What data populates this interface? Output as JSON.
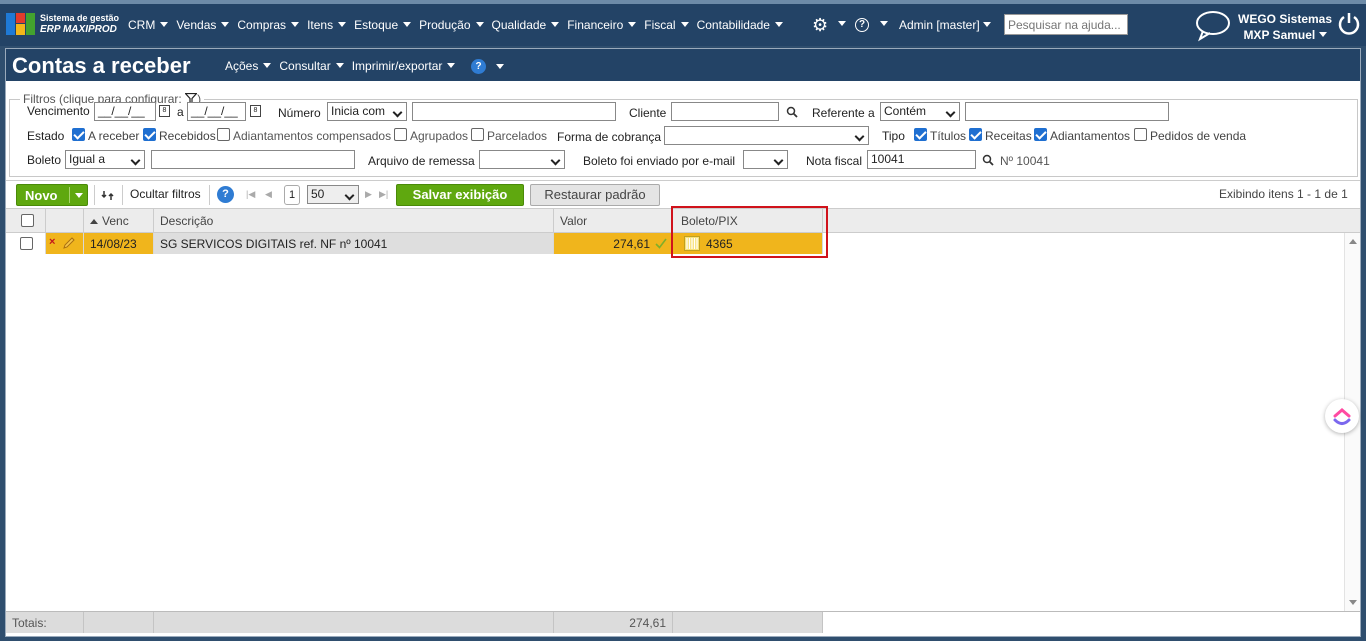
{
  "topbar": {
    "brand_line1": "Sistema de gestão",
    "brand_line2": "ERP MAXIPROD",
    "menu": [
      "CRM",
      "Vendas",
      "Compras",
      "Itens",
      "Estoque",
      "Produção",
      "Qualidade",
      "Financeiro",
      "Fiscal",
      "Contabilidade"
    ],
    "admin_label": "Admin [master]",
    "help_search_placeholder": "Pesquisar na ajuda...",
    "org_line1": "WEGO Sistemas",
    "org_line2": "MXP Samuel",
    "colors": {
      "nav_bg": "#234366",
      "accent_green": "#5fa80f",
      "row_highlight": "#f0b51c"
    }
  },
  "page": {
    "title": "Contas a receber",
    "menu": [
      "Ações",
      "Consultar",
      "Imprimir/exportar"
    ],
    "help_icon": "?"
  },
  "filters": {
    "legend": "Filtros (clique para configurar:",
    "legend_close": ")",
    "vencimento_label": "Vencimento",
    "date_placeholder": "__/__/__",
    "a_label": "a",
    "numero_label": "Número",
    "numero_mode": "Inicia com",
    "cliente_label": "Cliente",
    "referente_label": "Referente a",
    "referente_mode": "Contém",
    "estado_label": "Estado",
    "estado_options": [
      {
        "label": "A receber",
        "checked": true
      },
      {
        "label": "Recebidos",
        "checked": true
      },
      {
        "label": "Adiantamentos compensados",
        "checked": false
      },
      {
        "label": "Agrupados",
        "checked": false
      },
      {
        "label": "Parcelados",
        "checked": false
      }
    ],
    "forma_label": "Forma de cobrança",
    "tipo_label": "Tipo",
    "tipo_options": [
      {
        "label": "Títulos",
        "checked": true
      },
      {
        "label": "Receitas",
        "checked": true
      },
      {
        "label": "Adiantamentos",
        "checked": true
      },
      {
        "label": "Pedidos de venda",
        "checked": false
      }
    ],
    "boleto_label": "Boleto",
    "boleto_mode": "Igual a",
    "arquivo_label": "Arquivo de remessa",
    "enviado_label": "Boleto foi enviado por e-mail",
    "nota_label": "Nota fiscal",
    "nota_value": "10041",
    "nota_result": "Nº 10041"
  },
  "toolbar": {
    "novo_label": "Novo",
    "ocultar_label": "Ocultar filtros",
    "page_number": "1",
    "page_size": "50",
    "salvar_label": "Salvar exibição",
    "restaurar_label": "Restaurar padrão",
    "exibindo_label": "Exibindo itens 1 - 1 de 1"
  },
  "grid": {
    "columns": {
      "venc": "Venc",
      "descricao": "Descrição",
      "valor": "Valor",
      "boleto": "Boleto/PIX"
    },
    "rows": [
      {
        "venc": "14/08/23",
        "descricao": "SG SERVICOS DIGITAIS ref. NF nº 10041",
        "valor": "274,61",
        "boleto": "4365"
      }
    ],
    "totals_label": "Totais:",
    "totals_valor": "274,61"
  }
}
